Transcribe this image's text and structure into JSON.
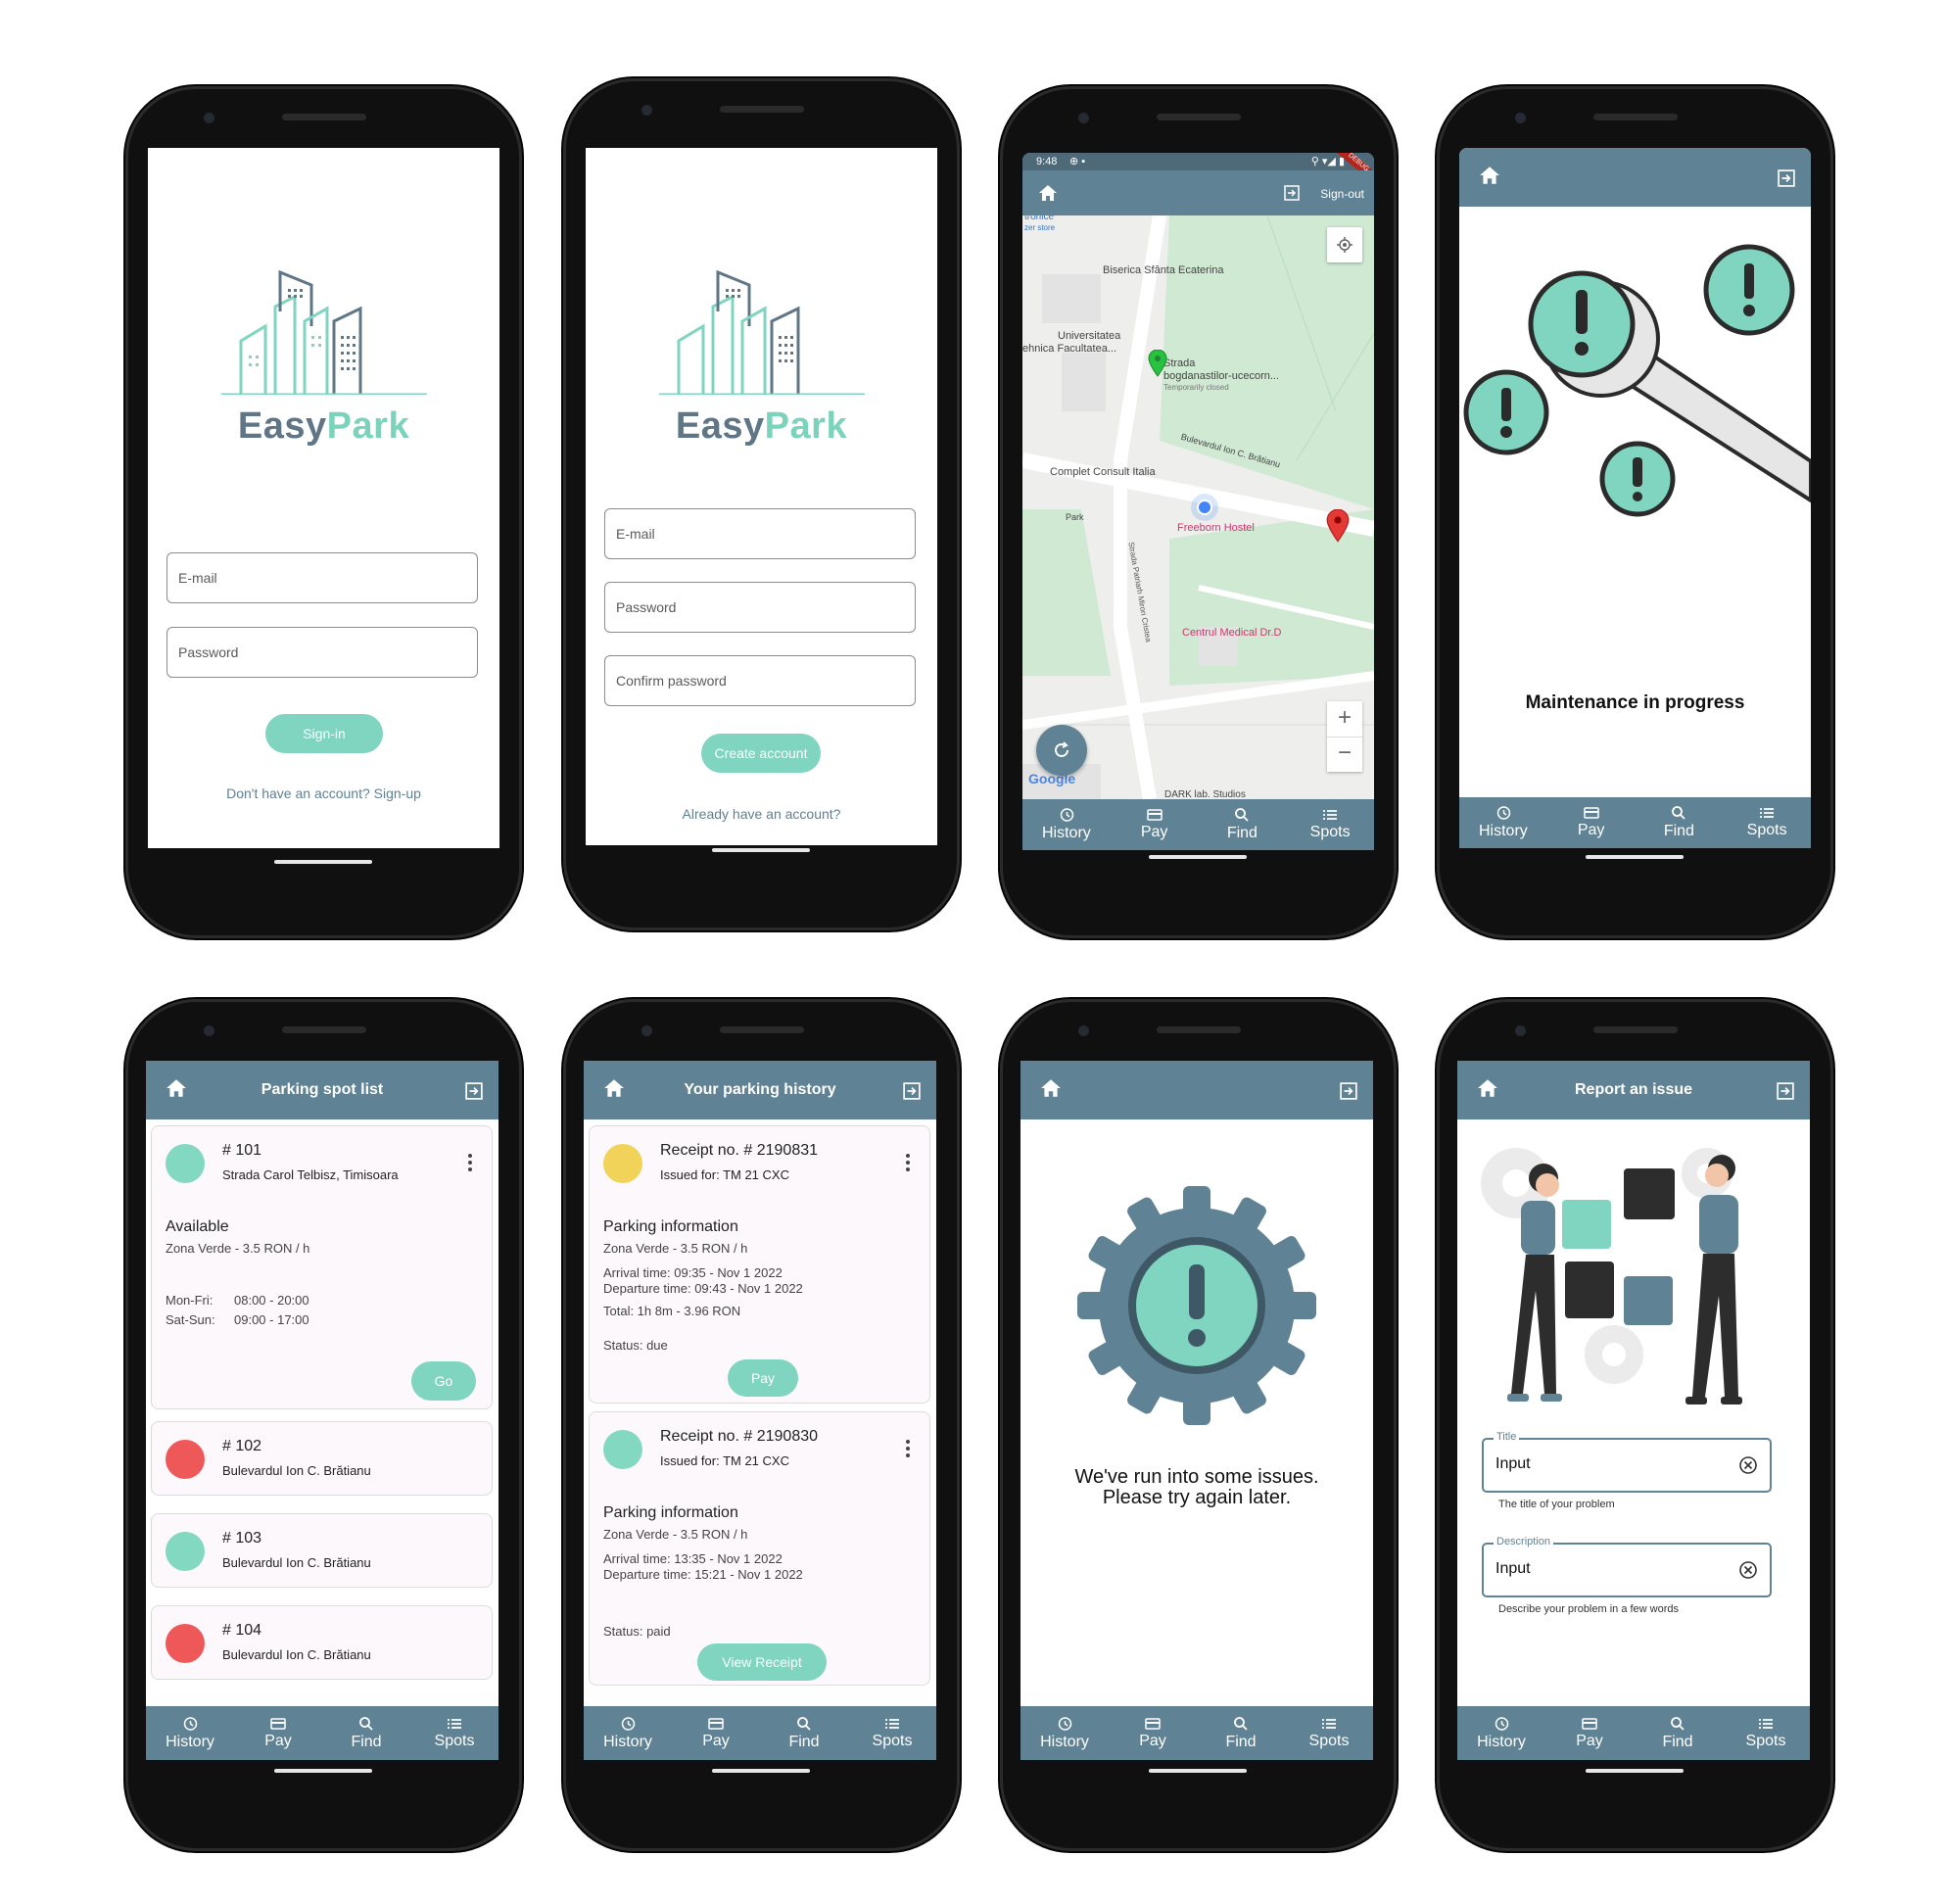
{
  "brand": {
    "part1": "Easy",
    "part2": "Park"
  },
  "nav": {
    "history": "History",
    "pay": "Pay",
    "find": "Find",
    "spots": "Spots"
  },
  "signin": {
    "email_placeholder": "E-mail",
    "password_placeholder": "Password",
    "button": "Sign-in",
    "signup_link": "Don't have an account? Sign-up"
  },
  "signup": {
    "email_placeholder": "E-mail",
    "password_placeholder": "Password",
    "confirm_placeholder": "Confirm password",
    "button": "Create account",
    "signin_link": "Already have an account?"
  },
  "map": {
    "status_time": "9:48",
    "debug_banner": "DEBUG",
    "signout": "Sign-out",
    "labels": {
      "l1": "tronice",
      "l2": "zer store",
      "church": "Biserica Sfânta Ecaterina",
      "univ1": "Universitatea",
      "univ2": "ehnica Facultatea...",
      "strada1": "Strada",
      "strada2": "bogdanastilor-ucecorn...",
      "closed": "Temporarily closed",
      "blvd": "Bulevardul Ion C. Brătianu",
      "consult": "Complet Consult Italia",
      "park": "Park",
      "hostel": "Freeborn Hostel",
      "street": "Strada Patriarh Miron Cristea",
      "medical": "Centrul Medical Dr.D",
      "dark": "DARK lab. Studios",
      "google": "Google"
    },
    "zoom_in": "+",
    "zoom_out": "−"
  },
  "maintenance": {
    "message": "Maintenance in progress"
  },
  "spots": {
    "title": "Parking spot list",
    "items": [
      {
        "number": "# 101",
        "address": "Strada Carol Telbisz, Timisoara",
        "status": "Available",
        "zone": "Zona Verde - 3.5 RON / h",
        "hours1_label": "Mon-Fri:",
        "hours1": "08:00 - 20:00",
        "hours2_label": "Sat-Sun:",
        "hours2": "09:00 - 17:00",
        "button": "Go",
        "color": "#82d8c0"
      },
      {
        "number": "# 102",
        "address": "Bulevardul Ion C. Brătianu",
        "color": "#ef5858"
      },
      {
        "number": "# 103",
        "address": "Bulevardul Ion C. Brătianu",
        "color": "#82d8c0"
      },
      {
        "number": "# 104",
        "address": "Bulevardul Ion C. Brătianu",
        "color": "#ef5858"
      }
    ]
  },
  "history": {
    "title": "Your parking history",
    "receipts": [
      {
        "number": "Receipt no. # 2190831",
        "issued": "Issued for: TM 21 CXC",
        "section": "Parking information",
        "zone": "Zona Verde - 3.5 RON / h",
        "arrival": "Arrival time: 09:35 - Nov 1 2022",
        "departure": "Departure  time: 09:43 - Nov 1 2022",
        "total": "Total: 1h 8m - 3.96 RON",
        "status": "Status: due",
        "button": "Pay",
        "color": "#f2d35a"
      },
      {
        "number": "Receipt no. # 2190830",
        "issued": "Issued for: TM 21 CXC",
        "section": "Parking information",
        "zone": "Zona Verde - 3.5 RON / h",
        "arrival": "Arrival time: 13:35 - Nov 1 2022",
        "departure": "Departure  time: 15:21 - Nov 1 2022",
        "status": "Status: paid",
        "button": "View Receipt",
        "color": "#82d8c0"
      }
    ]
  },
  "error": {
    "line1": "We've run into some issues.",
    "line2": "Please try again later."
  },
  "report": {
    "title": "Report an issue",
    "title_label": "Title",
    "title_value": "Input",
    "title_helper": "The title of your problem",
    "desc_label": "Description",
    "desc_value": "Input",
    "desc_helper": "Describe your problem in a few words"
  },
  "colors": {
    "primary": "#5f8295",
    "accent": "#7fd5bf",
    "red": "#ef5858",
    "yellow": "#f2d35a"
  }
}
